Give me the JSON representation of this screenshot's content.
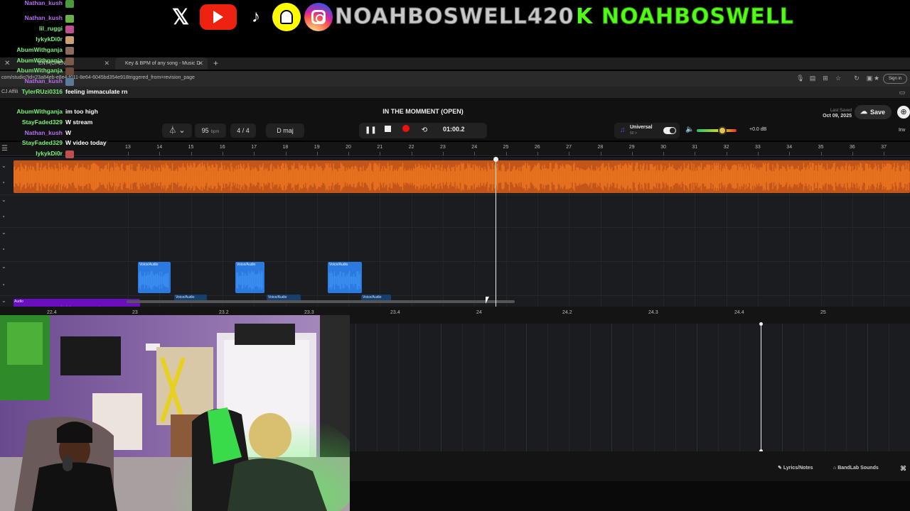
{
  "banner": {
    "icons": [
      "x-icon",
      "youtube-icon",
      "tiktok-icon",
      "snapchat-icon",
      "instagram-icon"
    ],
    "handle": "NOAHBOSWELL420",
    "kick_letter": "K",
    "kick_handle": "NOAHBOSWELL",
    "colors": {
      "kick": "#53fc18",
      "handle": "#c9c9c9"
    }
  },
  "browser": {
    "tabs": [
      {
        "label": "ENT (OPEN)"
      },
      {
        "label": "Key & BPM of any song - Music D"
      }
    ],
    "address": "com/studio?id=23a84eb-e8e4-f011-8e64-6045bd354e918triggered_from=revision_page",
    "bookmark": "CJ Affili",
    "signin": "Sign in"
  },
  "studio": {
    "title": "IN THE MOMMENT (OPEN)",
    "last_saved_label": "Last Saved",
    "last_saved_date": "Oct 09, 2025",
    "save_label": "Save",
    "bpm": "95",
    "bpm_unit": "bpm",
    "time_signature": "4 / 4",
    "key": "D maj",
    "time": "01:00.2",
    "preset": "Universal",
    "preset_sub": "50 >",
    "gain": "+0.0 dB",
    "volume_level": 0.65,
    "inv": "Inv",
    "ruler_bars": [
      "13",
      "14",
      "15",
      "16",
      "17",
      "18",
      "19",
      "20",
      "21",
      "22",
      "23",
      "24",
      "25",
      "26",
      "27",
      "28",
      "29",
      "30",
      "31",
      "32",
      "33",
      "34",
      "35",
      "36",
      "37"
    ],
    "clip_audio_label": "Audio",
    "voice_clip_label": "Voice/Audio",
    "ruler2": [
      "22.4",
      "23",
      "23.2",
      "23.3",
      "23.4",
      "24",
      "24.2",
      "24.3",
      "24.4",
      "25"
    ],
    "bottom": {
      "lyrics": "Lyrics/Notes",
      "bandlab": "BandLab Sounds"
    },
    "colors": {
      "orange": "#e8721f",
      "purple": "#8a1ee0",
      "blue": "#3a8ef0"
    }
  },
  "chat": [
    {
      "user": "Nathan_kush",
      "msg": "",
      "color": "#b86cf0"
    },
    {
      "user": "Nathan_kush",
      "msg": "",
      "color": "#b86cf0"
    },
    {
      "user": "lil_ruggi",
      "msg": "",
      "color": "#7cf07a"
    },
    {
      "user": "lykykDi0r",
      "msg": "",
      "color": "#7cf07a"
    },
    {
      "user": "AbumWithganja",
      "msg": "",
      "color": "#7cf07a"
    },
    {
      "user": "AbumWithganja",
      "msg": "",
      "color": "#7cf07a"
    },
    {
      "user": "AbumWithganja",
      "msg": "",
      "color": "#7cf07a"
    },
    {
      "user": "Nathan_kush",
      "msg": "",
      "color": "#b86cf0"
    },
    {
      "user": "TylerRUzi0316",
      "msg": "feeling immaculate rn",
      "color": "#7cf07a"
    },
    {
      "user": "AbumWithganja",
      "msg": "im too high",
      "color": "#7cf07a"
    },
    {
      "user": "StayFaded329",
      "msg": "W stream",
      "color": "#7cf07a"
    },
    {
      "user": "Nathan_kush",
      "msg": "W",
      "color": "#b86cf0"
    },
    {
      "user": "StayFaded329",
      "msg": "W video today",
      "color": "#7cf07a"
    },
    {
      "user": "lykykDi0r",
      "msg": "",
      "color": "#7cf07a"
    }
  ]
}
